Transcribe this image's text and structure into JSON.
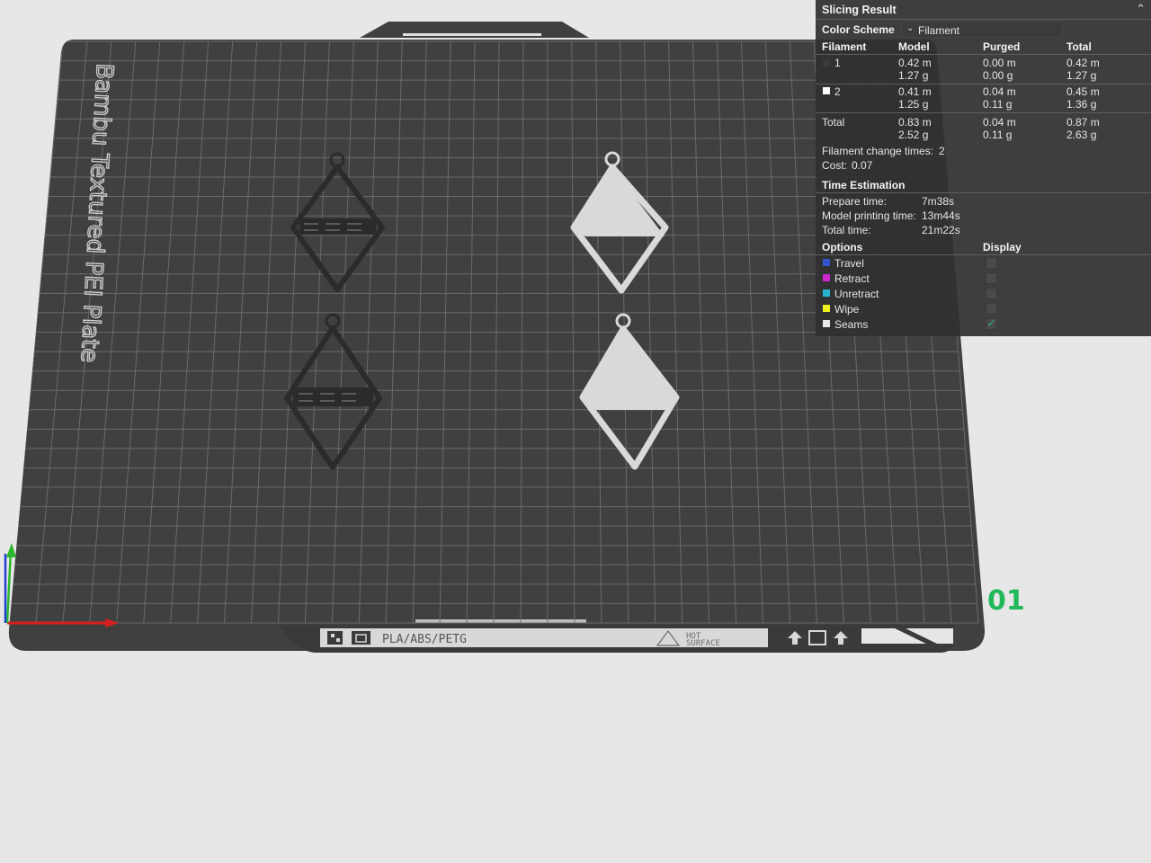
{
  "colors": {
    "background": "#e7e7e7",
    "plate": "#404040",
    "grid": "#6a6a6a",
    "panel": "#303030",
    "model_dark": "#2b2b2b",
    "model_light": "#d9d9d9",
    "plate_number": "#1fb85a"
  },
  "plate": {
    "name": "Bambu Textured PEI Plate",
    "materials": "PLA/ABS/PETG",
    "warning": [
      "HOT",
      "SURFACE"
    ],
    "number": "01",
    "warning_icon": "warning-triangle-icon",
    "bed_icons": [
      "qr-icon",
      "grid-logo-icon",
      "arrow-up-icon",
      "square-outline-icon",
      "arrow-up-icon"
    ]
  },
  "panel": {
    "title": "Slicing Result",
    "collapse_icon": "chevron-up-icon",
    "color_scheme": {
      "label": "Color Scheme",
      "value": "Filament",
      "icon": "chevron-down-icon"
    },
    "columns": [
      "Filament",
      "Model",
      "Purged",
      "Total"
    ],
    "rows": [
      {
        "id": "1",
        "swatch": "#3a3a3a",
        "model": [
          "0.42 m",
          "1.27 g"
        ],
        "purged": [
          "0.00 m",
          "0.00 g"
        ],
        "total": [
          "0.42 m",
          "1.27 g"
        ]
      },
      {
        "id": "2",
        "swatch": "#ffffff",
        "model": [
          "0.41 m",
          "1.25 g"
        ],
        "purged": [
          "0.04 m",
          "0.11 g"
        ],
        "total": [
          "0.45 m",
          "1.36 g"
        ]
      }
    ],
    "total_row": {
      "label": "Total",
      "model": [
        "0.83 m",
        "2.52 g"
      ],
      "purged": [
        "0.04 m",
        "0.11 g"
      ],
      "total": [
        "0.87 m",
        "2.63 g"
      ]
    },
    "filament_change": {
      "label": "Filament change times:",
      "value": "2"
    },
    "cost": {
      "label": "Cost:",
      "value": "0.07"
    },
    "time": {
      "title": "Time Estimation",
      "items": [
        {
          "label": "Prepare time:",
          "value": "7m38s"
        },
        {
          "label": "Model printing time:",
          "value": "13m44s"
        },
        {
          "label": "Total time:",
          "value": "21m22s"
        }
      ]
    },
    "options": {
      "title": "Options",
      "display_title": "Display",
      "items": [
        {
          "label": "Travel",
          "color": "#3355cc",
          "checked": false
        },
        {
          "label": "Retract",
          "color": "#d026d0",
          "checked": false
        },
        {
          "label": "Unretract",
          "color": "#26b3d0",
          "checked": false
        },
        {
          "label": "Wipe",
          "color": "#f2f21a",
          "checked": false
        },
        {
          "label": "Seams",
          "color": "#e8e8e8",
          "checked": true
        }
      ]
    }
  }
}
